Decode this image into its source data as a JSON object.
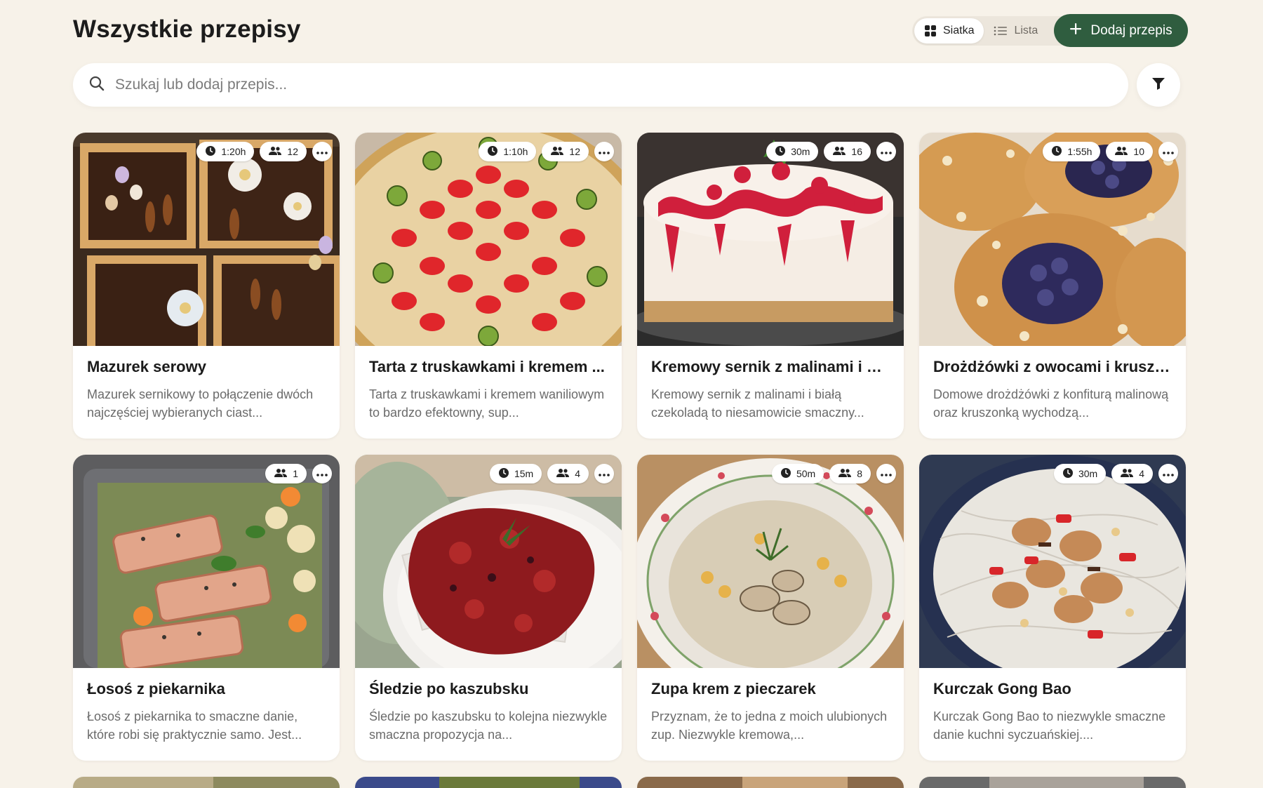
{
  "header": {
    "title": "Wszystkie przepisy",
    "view_grid_label": "Siatka",
    "view_list_label": "Lista",
    "add_label": "Dodaj przepis"
  },
  "search": {
    "placeholder": "Szukaj lub dodaj przepis..."
  },
  "colors": {
    "background": "#f7f2e9",
    "accent": "#2f5d3f",
    "card": "#ffffff"
  },
  "recipes": [
    {
      "title": "Mazurek serowy",
      "description": "Mazurek sernikowy to połączenie dwóch najczęściej wybieranych ciast...",
      "time": "1:20h",
      "servings": "12",
      "image": "mazurek-photo"
    },
    {
      "title": "Tarta z truskawkami i kremem ...",
      "description": "Tarta z truskawkami i kremem waniliowym to bardzo efektowny, sup...",
      "time": "1:10h",
      "servings": "12",
      "image": "strawberry-tart-photo"
    },
    {
      "title": "Kremowy sernik z malinami i bi...",
      "description": "Kremowy sernik z malinami i białą czekoladą to niesamowicie smaczny...",
      "time": "30m",
      "servings": "16",
      "image": "raspberry-cheesecake-photo"
    },
    {
      "title": "Drożdżówki z owocami i kruszo...",
      "description": "Domowe drożdżówki z konfiturą malinową oraz kruszonką wychodzą...",
      "time": "1:55h",
      "servings": "10",
      "image": "sweet-buns-photo"
    },
    {
      "title": "Łosoś z piekarnika",
      "description": "Łosoś z piekarnika to smaczne danie, które robi się praktycznie samo. Jest...",
      "time": "",
      "servings": "1",
      "image": "baked-salmon-photo"
    },
    {
      "title": "Śledzie po kaszubsku",
      "description": "Śledzie po kaszubsku to kolejna niezwykle smaczna propozycja na...",
      "time": "15m",
      "servings": "4",
      "image": "herring-photo"
    },
    {
      "title": "Zupa krem z pieczarek",
      "description": "Przyznam, że to jedna z moich ulubionych zup. Niezwykle kremowa,...",
      "time": "50m",
      "servings": "8",
      "image": "mushroom-soup-photo"
    },
    {
      "title": "Kurczak Gong Bao",
      "description": "Kurczak Gong Bao to niezwykle smaczne danie kuchni syczuańskiej....",
      "time": "30m",
      "servings": "4",
      "image": "kung-pao-chicken-photo"
    }
  ]
}
